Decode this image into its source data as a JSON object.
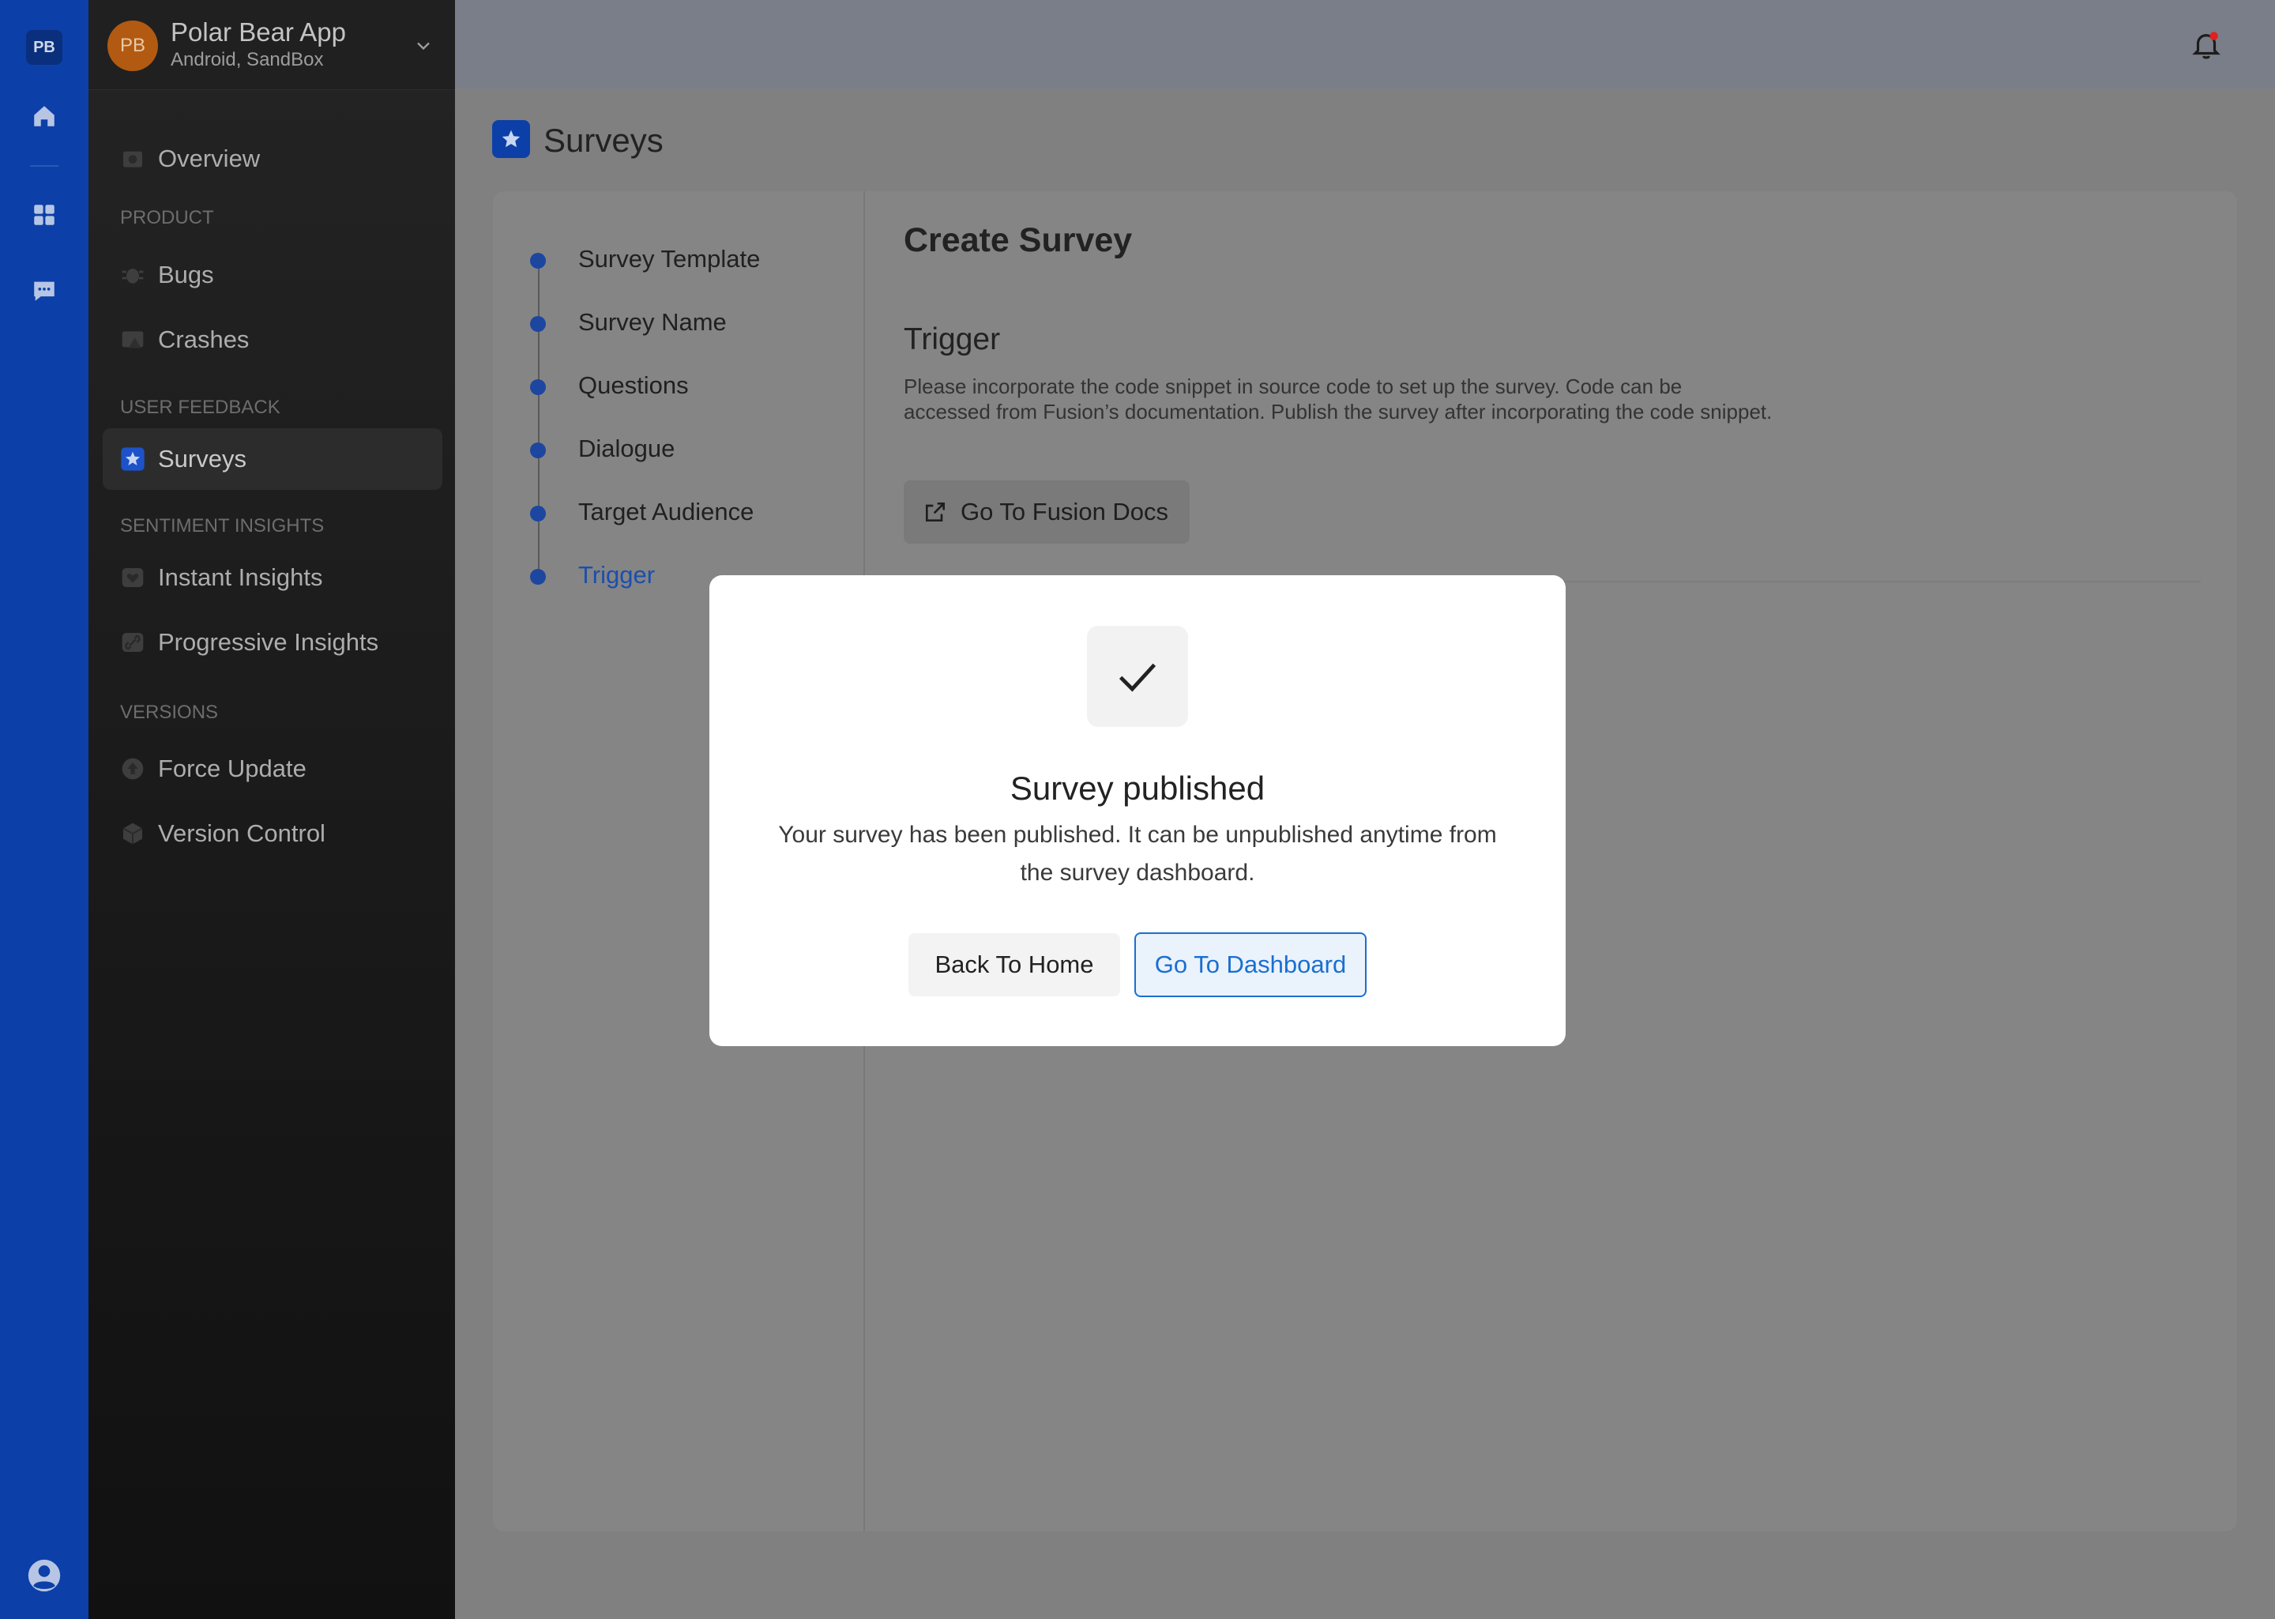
{
  "rail": {
    "logo": "PB",
    "icons": [
      "home-icon",
      "grid-icon",
      "chat-icon",
      "user-circle-icon"
    ]
  },
  "app_switcher": {
    "avatar": "PB",
    "name": "Polar Bear App",
    "subtitle": "Android, SandBox"
  },
  "sidebar": {
    "overview": "Overview",
    "sections": {
      "product": "PRODUCT",
      "user_feedback": "USER FEEDBACK",
      "sentiment": "SENTIMENT INSIGHTS",
      "versions": "VERSIONS"
    },
    "items": {
      "bugs": "Bugs",
      "crashes": "Crashes",
      "surveys": "Surveys",
      "instant_insights": "Instant Insights",
      "progressive_insights": "Progressive Insights",
      "force_update": "Force Update",
      "version_control": "Version Control"
    }
  },
  "page": {
    "title": "Surveys"
  },
  "steps": [
    {
      "label": "Survey Template"
    },
    {
      "label": "Survey Name"
    },
    {
      "label": "Questions"
    },
    {
      "label": "Dialogue"
    },
    {
      "label": "Target Audience"
    },
    {
      "label": "Trigger"
    }
  ],
  "form": {
    "heading": "Create Survey",
    "section_title": "Trigger",
    "description": "Please incorporate the code snippet in source code to set up the survey. Code can be accessed from Fusion’s documentation. Publish the survey after incorporating the code snippet.",
    "docs_button": "Go To Fusion Docs"
  },
  "modal": {
    "title": "Survey published",
    "text": "Your survey has been published. It can be unpublished anytime from the survey dashboard.",
    "back_button": "Back To Home",
    "dashboard_button": "Go To Dashboard"
  },
  "colors": {
    "rail": "#0c40a8",
    "accent": "#1a6fd0",
    "notification_dot": "#e02020"
  }
}
